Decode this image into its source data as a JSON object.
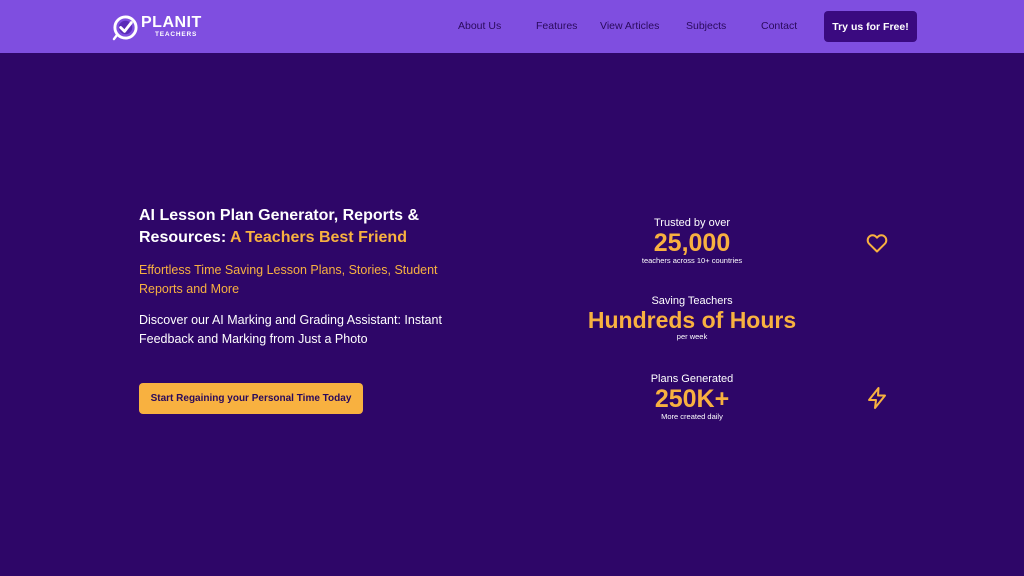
{
  "header": {
    "logo": {
      "word": "PLANIT",
      "sub": "TEACHERS"
    },
    "nav": [
      "About Us",
      "Features",
      "View Articles",
      "Subjects",
      "Contact"
    ],
    "cta_label": "Try us for Free!"
  },
  "hero": {
    "title_main": "AI Lesson Plan Generator, Reports & Resources:",
    "title_accent": "A Teachers Best Friend",
    "subtitle": "Effortless Time Saving Lesson Plans, Stories, Student Reports and More",
    "description": "Discover our AI Marking and Grading Assistant: Instant Feedback and Marking from Just a Photo",
    "cta_label": "Start Regaining your Personal Time Today"
  },
  "stats": [
    {
      "label": "Trusted by over",
      "value": "25,000",
      "note": "teachers across 10+ countries",
      "icon": "heart-icon"
    },
    {
      "label": "Saving Teachers",
      "value": "Hundreds of Hours",
      "note": "per week",
      "icon": ""
    },
    {
      "label": "Plans Generated",
      "value": "250K+",
      "note": "More created daily",
      "icon": "lightning-icon"
    }
  ],
  "colors": {
    "background": "#2e0668",
    "header": "#7f4ee0",
    "accent": "#f8b140",
    "button_dark": "#3a0a80"
  }
}
